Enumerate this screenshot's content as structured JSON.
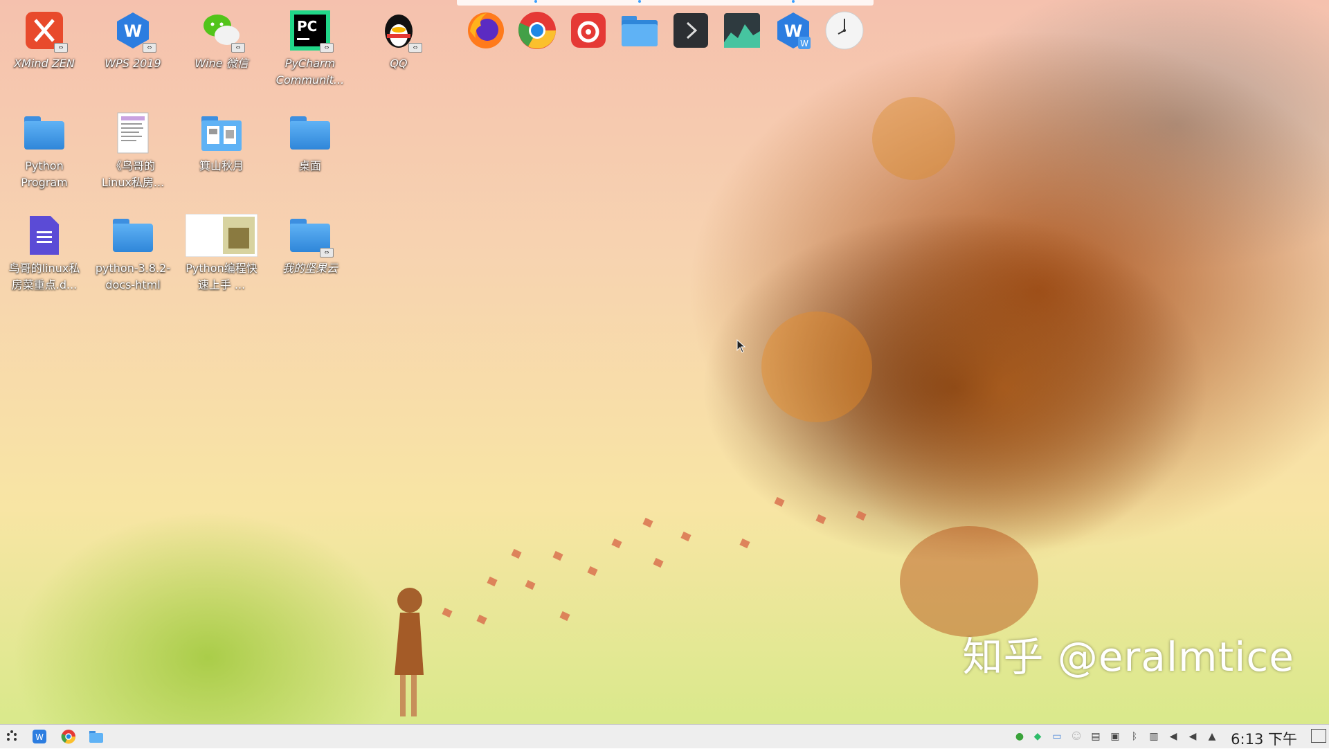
{
  "desktop": {
    "icons": [
      {
        "label": "XMind ZEN"
      },
      {
        "label": "WPS 2019"
      },
      {
        "label": "Wine 微信"
      },
      {
        "label": "PyCharm\nCommunit..."
      },
      {
        "label": "QQ"
      },
      {
        "label": "Python\nProgram"
      },
      {
        "label": "《鸟哥的\nLinux私房..."
      },
      {
        "label": "箕山秋月"
      },
      {
        "label": "桌面"
      },
      {
        "label": "鸟哥的linux私\n房菜重点.d..."
      },
      {
        "label": "python-3.8.2-\ndocs-html"
      },
      {
        "label": "Python编程快\n速上手 ..."
      },
      {
        "label": "我的坚果云"
      }
    ],
    "watermark": "知乎 @eralmtice",
    "pycharm_glyph": "PC"
  },
  "dock": {
    "items": [
      {
        "icon": "firefox-icon"
      },
      {
        "icon": "chrome-icon"
      },
      {
        "icon": "netease-music-icon"
      },
      {
        "icon": "file-manager-icon"
      },
      {
        "icon": "terminal-icon"
      },
      {
        "icon": "system-monitor-icon"
      },
      {
        "icon": "wps-writer-icon"
      },
      {
        "icon": "clock-icon"
      }
    ]
  },
  "taskbar": {
    "clock": "6:13 下午",
    "tray_icons": [
      "update-icon",
      "ghost-icon",
      "keyboard-icon",
      "people-icon",
      "clipboard-icon",
      "printer-icon",
      "bluetooth-icon",
      "network-icon",
      "speaker-icon",
      "volume-icon",
      "expand-tray-icon"
    ]
  },
  "colors": {
    "taskbar_bg": "#eeeeee",
    "folder_blue": "#3d8fe0",
    "accent_orange": "#c9611c"
  }
}
